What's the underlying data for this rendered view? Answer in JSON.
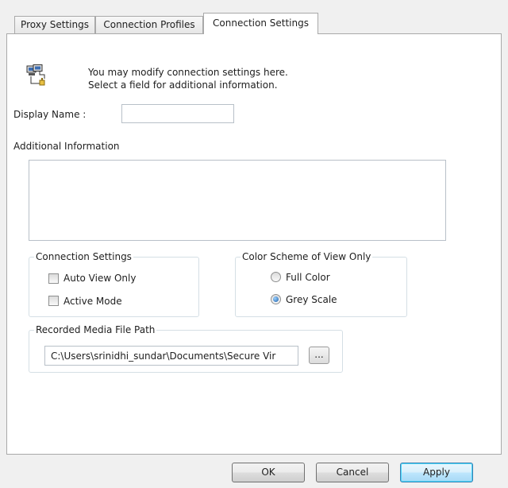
{
  "tabs": [
    {
      "label": "Proxy Settings"
    },
    {
      "label": "Connection Profiles"
    },
    {
      "label": "Connection Settings"
    }
  ],
  "info": {
    "icon": "network-computers-icon",
    "line1": "You may modify connection settings here.",
    "line2": "Select a field for additional information."
  },
  "display_name": {
    "label": "Display Name :",
    "value": ""
  },
  "additional_info": {
    "label": "Additional Information",
    "value": ""
  },
  "connection_settings": {
    "legend": "Connection Settings",
    "auto_view_only": {
      "label": "Auto View Only",
      "checked": false
    },
    "active_mode": {
      "label": "Active Mode",
      "checked": false
    }
  },
  "color_scheme": {
    "legend": "Color Scheme of View Only",
    "full_color": {
      "label": "Full Color",
      "selected": false
    },
    "grey_scale": {
      "label": "Grey Scale",
      "selected": true
    }
  },
  "recorded_media": {
    "legend": "Recorded Media File Path",
    "path": "C:\\Users\\srinidhi_sundar\\Documents\\Secure Vir",
    "browse_label": "..."
  },
  "buttons": {
    "ok": "OK",
    "cancel": "Cancel",
    "apply": "Apply"
  },
  "colors": {
    "panel_background": "#ffffff",
    "window_background": "#f0f0f0",
    "default_button_border": "#3c7fb1",
    "radio_selected": "#1f5fa8"
  }
}
